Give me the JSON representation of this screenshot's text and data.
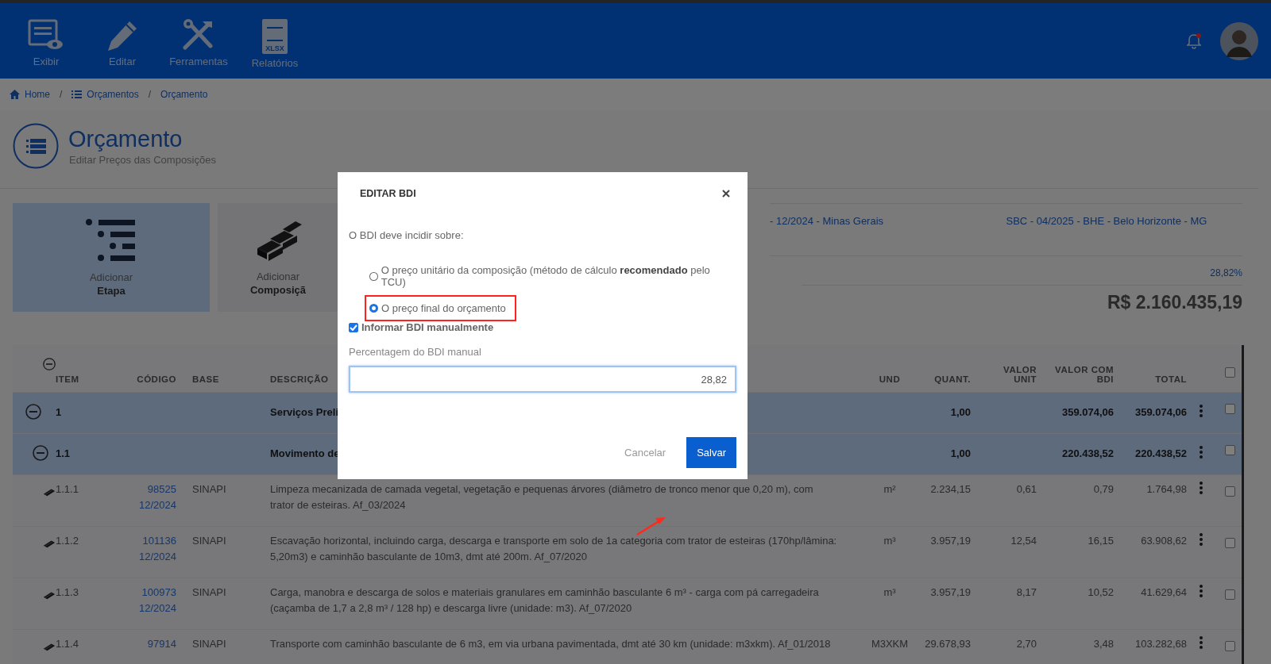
{
  "toolbar": [
    {
      "label": "Exibir"
    },
    {
      "label": "Editar"
    },
    {
      "label": "Ferramentas"
    },
    {
      "label": "Relatórios",
      "icon_text": "XLSX"
    }
  ],
  "notifications": {
    "unread": true
  },
  "breadcrumb": {
    "separator": "/",
    "items": [
      {
        "label": "Home"
      },
      {
        "label": "Orçamentos"
      },
      {
        "label": "Orçamento"
      }
    ]
  },
  "page": {
    "title": "Orçamento",
    "subtitle": "Editar Preços das Composições"
  },
  "cards": [
    {
      "label": "Adicionar",
      "sub": "Etapa",
      "selected": true
    },
    {
      "label": "Adicionar",
      "sub": "Composiçã",
      "selected": false
    }
  ],
  "info": {
    "sources": [
      "- 12/2024 - Minas Gerais",
      "SBC - 04/2025 - BHE - Belo Horizonte - MG"
    ],
    "bdi": "28,82%",
    "total": "R$ 2.160.435,19"
  },
  "table": {
    "columns": [
      "ITEM",
      "CÓDIGO",
      "BASE",
      "DESCRIÇÃO",
      "UND",
      "QUANT.",
      "VALOR UNIT",
      "VALOR COM BDI",
      "TOTAL"
    ],
    "all_checked": false,
    "rows": [
      {
        "kind": "group",
        "item": "1",
        "description": "Serviços Preli",
        "quantity": "1,00",
        "value_with_bdi": "359.074,06",
        "total": "359.074,06",
        "checked": false,
        "children": [
          {
            "kind": "group",
            "item": "1.1",
            "description": "Movimento de",
            "quantity": "1,00",
            "value_with_bdi": "220.438,52",
            "total": "220.438,52",
            "checked": false,
            "children": [
              {
                "kind": "composition",
                "item": "1.1.1",
                "code": "98525",
                "code_ref": "12/2024",
                "base": "SINAPI",
                "description": "Limpeza mecanizada de camada vegetal, vegetação e pequenas árvores (diâmetro de tronco menor que 0,20 m), com trator de esteiras. Af_03/2024",
                "unit": "m²",
                "quantity": "2.234,15",
                "unit_value": "0,61",
                "value_with_bdi": "0,79",
                "total": "1.764,98",
                "checked": false
              },
              {
                "kind": "composition",
                "item": "1.1.2",
                "code": "101136",
                "code_ref": "12/2024",
                "base": "SINAPI",
                "description": "Escavação horizontal, incluindo carga, descarga e transporte em solo de 1a categoria com trator de esteiras (170hp/lâmina: 5,20m3) e caminhão basculante de 10m3, dmt até 200m. Af_07/2020",
                "unit": "m³",
                "quantity": "3.957,19",
                "unit_value": "12,54",
                "value_with_bdi": "16,15",
                "total": "63.908,62",
                "checked": false
              },
              {
                "kind": "composition",
                "item": "1.1.3",
                "code": "100973",
                "code_ref": "12/2024",
                "base": "SINAPI",
                "description": "Carga, manobra e descarga de solos e materiais granulares em caminhão basculante 6 m³ - carga com pá carregadeira (caçamba de 1,7 a 2,8 m³ / 128 hp) e descarga livre (unidade: m3). Af_07/2020",
                "unit": "m³",
                "quantity": "3.957,19",
                "unit_value": "8,17",
                "value_with_bdi": "10,52",
                "total": "41.629,64",
                "checked": false
              },
              {
                "kind": "composition",
                "item": "1.1.4",
                "code": "97914",
                "base": "SINAPI",
                "description": "Transporte com caminhão basculante de 6 m3, em via urbana pavimentada, dmt até 30 km (unidade: m3xkm). Af_01/2018",
                "unit": "M3XKM",
                "quantity": "29.678,93",
                "unit_value": "2,70",
                "value_with_bdi": "3,48",
                "total": "103.282,68",
                "checked": false
              }
            ]
          }
        ]
      }
    ]
  },
  "modal": {
    "title": "EDITAR BDI",
    "question": "O BDI deve incidir sobre:",
    "options": [
      {
        "label": "O preço unitário da composição (método de cálculo **recomendado** pelo TCU)",
        "selected": false,
        "highlighted": false
      },
      {
        "label": "O preço final do orçamento",
        "selected": true,
        "highlighted": true
      }
    ],
    "manual": {
      "label": "Informar BDI manualmente",
      "checked": true
    },
    "field": {
      "label": "Percentagem do BDI manual",
      "value": "28,82"
    },
    "cancel": "Cancelar",
    "save": "Salvar"
  }
}
